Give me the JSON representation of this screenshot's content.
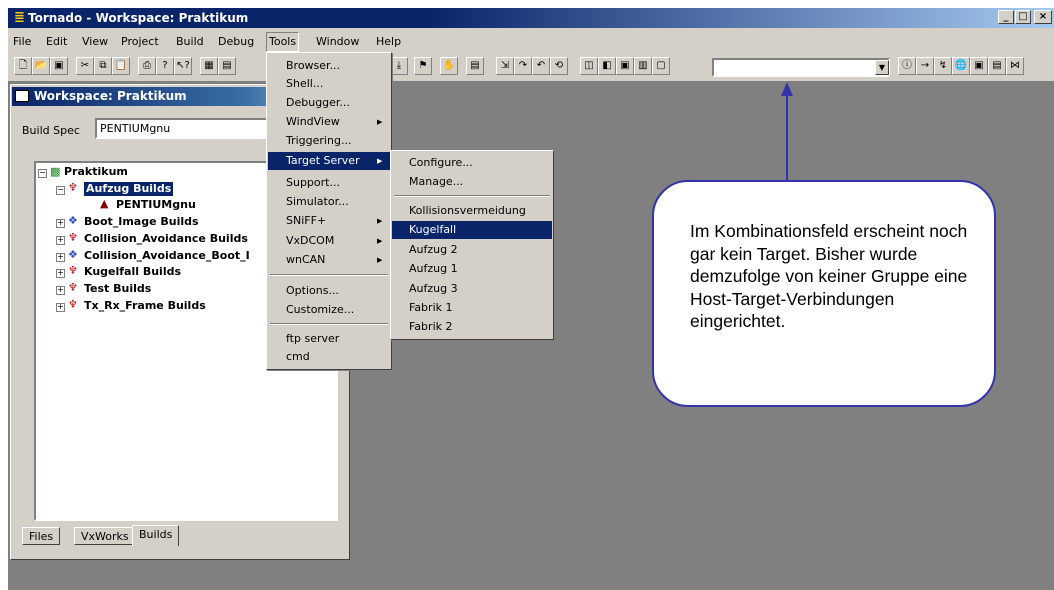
{
  "window": {
    "title": "Tornado - Workspace: Praktikum",
    "minimize": "_",
    "maximize": "□",
    "close": "×"
  },
  "menubar": [
    "File",
    "Edit",
    "View",
    "Project",
    "Build",
    "Debug",
    "Tools",
    "Window",
    "Help"
  ],
  "tools_menu": [
    {
      "label": "Browser..."
    },
    {
      "label": "Shell..."
    },
    {
      "label": "Debugger..."
    },
    {
      "label": "WindView",
      "submenu": true
    },
    {
      "label": "Triggering..."
    },
    {
      "label": "Target Server",
      "submenu": true,
      "selected": true
    },
    {
      "label": "Support..."
    },
    {
      "label": "Simulator..."
    },
    {
      "label": "SNiFF+",
      "submenu": true
    },
    {
      "label": "VxDCOM",
      "submenu": true
    },
    {
      "label": "wnCAN",
      "submenu": true
    },
    {
      "label": "Options..."
    },
    {
      "label": "Customize..."
    },
    {
      "label": "ftp server"
    },
    {
      "label": "cmd"
    }
  ],
  "target_server_submenu": [
    {
      "label": "Configure..."
    },
    {
      "label": "Manage..."
    },
    {
      "label": "Kollisionsvermeidung"
    },
    {
      "label": "Kugelfall",
      "selected": true
    },
    {
      "label": "Aufzug 2"
    },
    {
      "label": "Aufzug 1"
    },
    {
      "label": "Aufzug 3"
    },
    {
      "label": "Fabrik 1"
    },
    {
      "label": "Fabrik 2"
    }
  ],
  "workspace": {
    "title": "Workspace: Praktikum",
    "build_spec_label": "Build Spec",
    "build_spec_value": "PENTIUMgnu",
    "tree": {
      "root": "Praktikum",
      "items": [
        {
          "label": "Aufzug Builds",
          "selected": true
        },
        {
          "label": "PENTIUMgnu"
        },
        {
          "label": "Boot_Image Builds"
        },
        {
          "label": "Collision_Avoidance Builds"
        },
        {
          "label": "Collision_Avoidance_Boot_I"
        },
        {
          "label": "Kugelfall Builds"
        },
        {
          "label": "Test Builds"
        },
        {
          "label": "Tx_Rx_Frame Builds"
        }
      ]
    },
    "tabs": [
      "Files",
      "VxWorks",
      "Builds"
    ]
  },
  "toolbar": {
    "combo_value": ""
  },
  "callout": {
    "text": "Im Kombinationsfeld erscheint noch gar kein Target. Bisher wurde demzufolge von keiner Gruppe eine Host-Target-Verbindungen eingerichtet."
  },
  "colors": {
    "selection": "#0a246a",
    "callout_border": "#3333aa",
    "mdi_background": "#808080"
  }
}
